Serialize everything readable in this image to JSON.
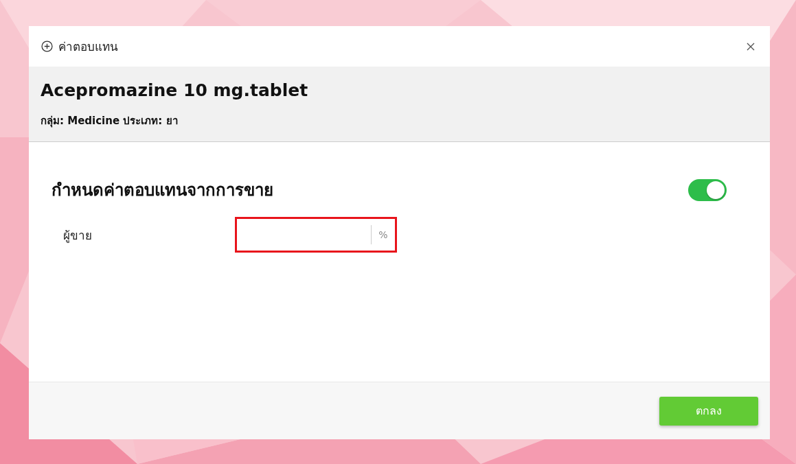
{
  "dialog": {
    "title": "ค่าตอบแทน",
    "product": "Acepromazine 10 mg.tablet",
    "meta": "กลุ่ม: Medicine ประเภท: ยา"
  },
  "section": {
    "title": "กำหนดค่าตอบแทนจากการขาย",
    "on": true
  },
  "fields": [
    {
      "label": "ผู้ขาย",
      "suffix": "%",
      "highlighted": true
    }
  ],
  "buttons": [
    {
      "label": "ตกลง"
    }
  ]
}
